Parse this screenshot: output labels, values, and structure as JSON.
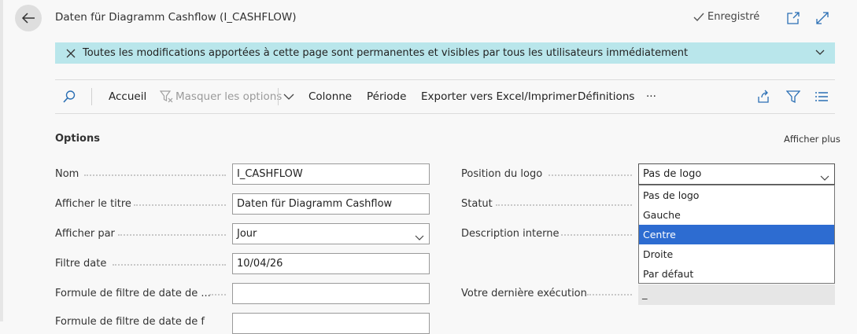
{
  "header": {
    "title": "Daten für Diagramm Cashflow (I_CASHFLOW)",
    "saved_label": "Enregistré",
    "back_icon": "arrow-left-icon",
    "open_new_window_icon": "open-in-new-window-icon",
    "expand_icon": "expand-icon"
  },
  "banner": {
    "message": "Toutes les modifications apportées à cette page sont permanentes et visibles par tous les utilisateurs immédiatement",
    "color": "#b9e6eb"
  },
  "toolbar": {
    "home": "Accueil",
    "hide_options": "Masquer les options",
    "column": "Colonne",
    "period": "Période",
    "export": "Exporter vers Excel/Imprimer",
    "definitions": "Définitions",
    "more": "···"
  },
  "options": {
    "section_title": "Options",
    "show_more": "Afficher plus",
    "fields": {
      "name": {
        "label": "Nom",
        "value": "I_CASHFLOW"
      },
      "show_title": {
        "label": "Afficher le titre",
        "value": "Daten für Diagramm Cashflow"
      },
      "show_by": {
        "label": "Afficher par",
        "value": "Jour"
      },
      "date_filter": {
        "label": "Filtre date",
        "value": "10/04/26"
      },
      "date_filter_formula": {
        "label": "Formule de filtre de date de ...",
        "value": ""
      },
      "next_label": {
        "label": "Formule de filtre de date de f",
        "value": ""
      },
      "logo_position": {
        "label": "Position du logo",
        "value": "Pas de logo"
      },
      "status": {
        "label": "Statut",
        "value": ""
      },
      "internal_description": {
        "label": "Description interne",
        "value": ""
      },
      "last_run": {
        "label": "Votre dernière exécution",
        "value": "_"
      }
    },
    "logo_options": [
      "Pas de logo",
      "Gauche",
      "Centre",
      "Droite",
      "Par défaut"
    ],
    "logo_selected_index": 2,
    "accent": "#2d6cd1"
  }
}
